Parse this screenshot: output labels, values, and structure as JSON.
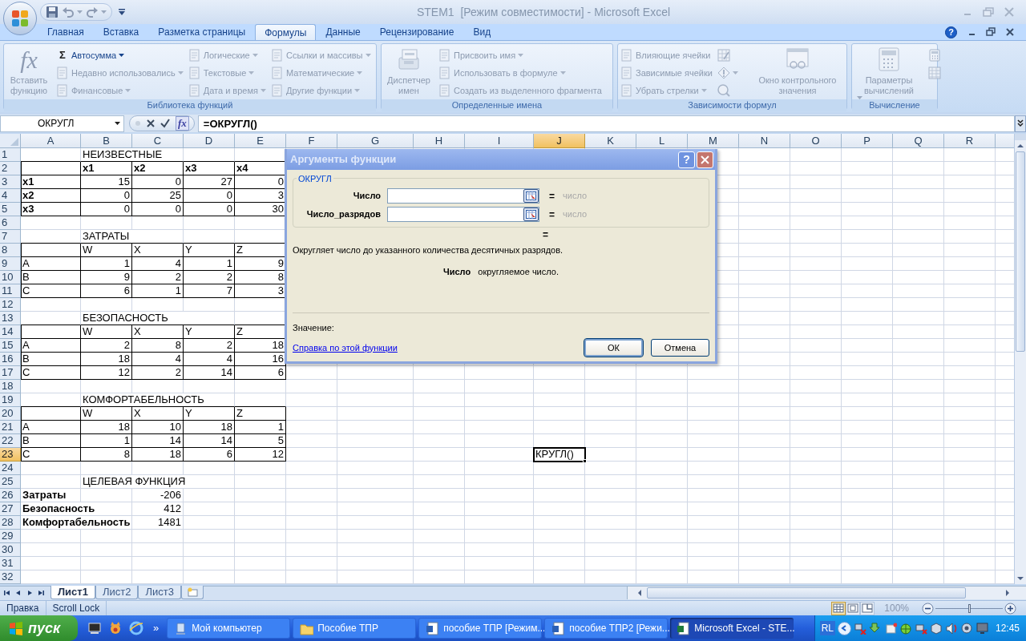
{
  "title_bar": {
    "title": "STEM1  [Режим совместимости] - Microsoft Excel"
  },
  "ribbon_tabs": [
    {
      "label": "Главная",
      "selected": false
    },
    {
      "label": "Вставка",
      "selected": false
    },
    {
      "label": "Разметка страницы",
      "selected": false
    },
    {
      "label": "Формулы",
      "selected": true
    },
    {
      "label": "Данные",
      "selected": false
    },
    {
      "label": "Рецензирование",
      "selected": false
    },
    {
      "label": "Вид",
      "selected": false
    }
  ],
  "ribbon_help": "?",
  "ribbon_groups": [
    {
      "label": "Библиотека функций",
      "items": [
        {
          "kind": "large",
          "label": "Вставить функцию",
          "symbol": "fx",
          "disabled": true,
          "dropdown": false
        },
        {
          "kind": "small",
          "label": "Автосумма",
          "symbol": "Σ",
          "disabled": false,
          "dropdown": true
        },
        {
          "kind": "small",
          "label": "Недавно использовались",
          "disabled": true,
          "dropdown": true
        },
        {
          "kind": "small",
          "label": "Финансовые",
          "disabled": true,
          "dropdown": true
        },
        {
          "kind": "small",
          "label": "Логические",
          "disabled": true,
          "dropdown": true
        },
        {
          "kind": "small",
          "label": "Текстовые",
          "disabled": true,
          "dropdown": true
        },
        {
          "kind": "small",
          "label": "Дата и время",
          "disabled": true,
          "dropdown": true
        },
        {
          "kind": "small",
          "label": "Ссылки и массивы",
          "disabled": true,
          "dropdown": true
        },
        {
          "kind": "small",
          "label": "Математические",
          "disabled": true,
          "dropdown": true
        },
        {
          "kind": "small",
          "label": "Другие функции",
          "disabled": true,
          "dropdown": true
        }
      ]
    },
    {
      "label": "Определенные имена",
      "items": [
        {
          "kind": "large",
          "label": "Диспетчер имен",
          "disabled": true,
          "dropdown": false
        },
        {
          "kind": "small",
          "label": "Присвоить имя",
          "disabled": true,
          "dropdown": true
        },
        {
          "kind": "small",
          "label": "Использовать в формуле",
          "disabled": true,
          "dropdown": true
        },
        {
          "kind": "small",
          "label": "Создать из выделенного фрагмента",
          "disabled": true,
          "dropdown": false
        }
      ]
    },
    {
      "label": "Зависимости формул",
      "items": [
        {
          "kind": "small",
          "label": "Влияющие ячейки",
          "disabled": true,
          "dropdown": false
        },
        {
          "kind": "small",
          "label": "Зависимые ячейки",
          "disabled": true,
          "dropdown": false
        },
        {
          "kind": "small",
          "label": "Убрать стрелки",
          "disabled": true,
          "dropdown": true
        },
        {
          "kind": "icon",
          "disabled": true,
          "dropdown": false
        },
        {
          "kind": "icon",
          "disabled": true,
          "dropdown": true
        },
        {
          "kind": "icon",
          "disabled": true,
          "dropdown": false
        },
        {
          "kind": "large",
          "label": "Окно контрольного значения",
          "disabled": true,
          "dropdown": false
        }
      ]
    },
    {
      "label": "Вычисление",
      "items": [
        {
          "kind": "large",
          "label": "Параметры вычислений",
          "disabled": true,
          "dropdown": true
        },
        {
          "kind": "icon",
          "disabled": true,
          "dropdown": false
        },
        {
          "kind": "icon",
          "disabled": true,
          "dropdown": false
        }
      ]
    }
  ],
  "formula_bar": {
    "name_box": "ОКРУГЛ",
    "function_button": "fx",
    "formula": "=ОКРУГЛ()"
  },
  "sheet": {
    "columns": [
      {
        "label": "A",
        "selected": false
      },
      {
        "label": "B",
        "selected": false
      },
      {
        "label": "C",
        "selected": false
      },
      {
        "label": "D",
        "selected": false
      },
      {
        "label": "E",
        "selected": false
      },
      {
        "label": "F",
        "selected": false
      },
      {
        "label": "G",
        "selected": false
      },
      {
        "label": "H",
        "selected": false
      },
      {
        "label": "I",
        "selected": false
      },
      {
        "label": "J",
        "selected": true
      },
      {
        "label": "K",
        "selected": false
      },
      {
        "label": "L",
        "selected": false
      },
      {
        "label": "M",
        "selected": false
      },
      {
        "label": "N",
        "selected": false
      },
      {
        "label": "O",
        "selected": false
      },
      {
        "label": "P",
        "selected": false
      },
      {
        "label": "Q",
        "selected": false
      },
      {
        "label": "R",
        "selected": false
      }
    ],
    "rows": [
      {
        "number": "1",
        "selected": false,
        "bordered": false,
        "cells": [
          null,
          {
            "text": "НЕИЗВЕСТНЫЕ",
            "kind": "text",
            "bold": false,
            "selected": false
          }
        ]
      },
      {
        "number": "2",
        "selected": false,
        "bordered": true,
        "cells": [
          null,
          {
            "text": "x1",
            "kind": "text",
            "bold": true,
            "selected": false
          },
          {
            "text": "x2",
            "kind": "text",
            "bold": true,
            "selected": false
          },
          {
            "text": "x3",
            "kind": "text",
            "bold": true,
            "selected": false
          },
          {
            "text": "x4",
            "kind": "text",
            "bold": true,
            "selected": false
          }
        ]
      },
      {
        "number": "3",
        "selected": false,
        "bordered": true,
        "cells": [
          {
            "text": "x1",
            "kind": "text",
            "bold": true,
            "selected": false
          },
          {
            "text": "15",
            "kind": "number",
            "bold": false,
            "selected": false
          },
          {
            "text": "0",
            "kind": "number",
            "bold": false,
            "selected": false
          },
          {
            "text": "27",
            "kind": "number",
            "bold": false,
            "selected": false
          },
          {
            "text": "0",
            "kind": "number",
            "bold": false,
            "selected": false
          }
        ]
      },
      {
        "number": "4",
        "selected": false,
        "bordered": true,
        "cells": [
          {
            "text": "x2",
            "kind": "text",
            "bold": true,
            "selected": false
          },
          {
            "text": "0",
            "kind": "number",
            "bold": false,
            "selected": false
          },
          {
            "text": "25",
            "kind": "number",
            "bold": false,
            "selected": false
          },
          {
            "text": "0",
            "kind": "number",
            "bold": false,
            "selected": false
          },
          {
            "text": "3",
            "kind": "number",
            "bold": false,
            "selected": false
          }
        ]
      },
      {
        "number": "5",
        "selected": false,
        "bordered": true,
        "cells": [
          {
            "text": "x3",
            "kind": "text",
            "bold": true,
            "selected": false
          },
          {
            "text": "0",
            "kind": "number",
            "bold": false,
            "selected": false
          },
          {
            "text": "0",
            "kind": "number",
            "bold": false,
            "selected": false
          },
          {
            "text": "0",
            "kind": "number",
            "bold": false,
            "selected": false
          },
          {
            "text": "30",
            "kind": "number",
            "bold": false,
            "selected": false
          }
        ]
      },
      {
        "number": "6",
        "selected": false,
        "bordered": false
      },
      {
        "number": "7",
        "selected": false,
        "bordered": false,
        "cells": [
          null,
          {
            "text": "ЗАТРАТЫ",
            "kind": "text",
            "bold": false,
            "selected": false
          }
        ]
      },
      {
        "number": "8",
        "selected": false,
        "bordered": true,
        "cells": [
          null,
          {
            "text": "W",
            "kind": "text",
            "bold": false,
            "selected": false
          },
          {
            "text": "X",
            "kind": "text",
            "bold": false,
            "selected": false
          },
          {
            "text": "Y",
            "kind": "text",
            "bold": false,
            "selected": false
          },
          {
            "text": "Z",
            "kind": "text",
            "bold": false,
            "selected": false
          }
        ]
      },
      {
        "number": "9",
        "selected": false,
        "bordered": true,
        "cells": [
          {
            "text": "A",
            "kind": "text",
            "bold": false,
            "selected": false
          },
          {
            "text": "1",
            "kind": "number",
            "bold": false,
            "selected": false
          },
          {
            "text": "4",
            "kind": "number",
            "bold": false,
            "selected": false
          },
          {
            "text": "1",
            "kind": "number",
            "bold": false,
            "selected": false
          },
          {
            "text": "9",
            "kind": "number",
            "bold": false,
            "selected": false
          }
        ]
      },
      {
        "number": "10",
        "selected": false,
        "bordered": true,
        "cells": [
          {
            "text": "B",
            "kind": "text",
            "bold": false,
            "selected": false
          },
          {
            "text": "9",
            "kind": "number",
            "bold": false,
            "selected": false
          },
          {
            "text": "2",
            "kind": "number",
            "bold": false,
            "selected": false
          },
          {
            "text": "2",
            "kind": "number",
            "bold": false,
            "selected": false
          },
          {
            "text": "8",
            "kind": "number",
            "bold": false,
            "selected": false
          }
        ]
      },
      {
        "number": "11",
        "selected": false,
        "bordered": true,
        "cells": [
          {
            "text": "C",
            "kind": "text",
            "bold": false,
            "selected": false
          },
          {
            "text": "6",
            "kind": "number",
            "bold": false,
            "selected": false
          },
          {
            "text": "1",
            "kind": "number",
            "bold": false,
            "selected": false
          },
          {
            "text": "7",
            "kind": "number",
            "bold": false,
            "selected": false
          },
          {
            "text": "3",
            "kind": "number",
            "bold": false,
            "selected": false
          }
        ]
      },
      {
        "number": "12",
        "selected": false,
        "bordered": false
      },
      {
        "number": "13",
        "selected": false,
        "bordered": false,
        "cells": [
          null,
          {
            "text": "БЕЗОПАСНОСТЬ",
            "kind": "text",
            "bold": false,
            "selected": false
          }
        ]
      },
      {
        "number": "14",
        "selected": false,
        "bordered": true,
        "cells": [
          null,
          {
            "text": "W",
            "kind": "text",
            "bold": false,
            "selected": false
          },
          {
            "text": "X",
            "kind": "text",
            "bold": false,
            "selected": false
          },
          {
            "text": "Y",
            "kind": "text",
            "bold": false,
            "selected": false
          },
          {
            "text": "Z",
            "kind": "text",
            "bold": false,
            "selected": false
          }
        ]
      },
      {
        "number": "15",
        "selected": false,
        "bordered": true,
        "cells": [
          {
            "text": "A",
            "kind": "text",
            "bold": false,
            "selected": false
          },
          {
            "text": "2",
            "kind": "number",
            "bold": false,
            "selected": false
          },
          {
            "text": "8",
            "kind": "number",
            "bold": false,
            "selected": false
          },
          {
            "text": "2",
            "kind": "number",
            "bold": false,
            "selected": false
          },
          {
            "text": "18",
            "kind": "number",
            "bold": false,
            "selected": false
          }
        ]
      },
      {
        "number": "16",
        "selected": false,
        "bordered": true,
        "cells": [
          {
            "text": "B",
            "kind": "text",
            "bold": false,
            "selected": false
          },
          {
            "text": "18",
            "kind": "number",
            "bold": false,
            "selected": false
          },
          {
            "text": "4",
            "kind": "number",
            "bold": false,
            "selected": false
          },
          {
            "text": "4",
            "kind": "number",
            "bold": false,
            "selected": false
          },
          {
            "text": "16",
            "kind": "number",
            "bold": false,
            "selected": false
          }
        ]
      },
      {
        "number": "17",
        "selected": false,
        "bordered": true,
        "cells": [
          {
            "text": "C",
            "kind": "text",
            "bold": false,
            "selected": false
          },
          {
            "text": "12",
            "kind": "number",
            "bold": false,
            "selected": false
          },
          {
            "text": "2",
            "kind": "number",
            "bold": false,
            "selected": false
          },
          {
            "text": "14",
            "kind": "number",
            "bold": false,
            "selected": false
          },
          {
            "text": "6",
            "kind": "number",
            "bold": false,
            "selected": false
          }
        ]
      },
      {
        "number": "18",
        "selected": false,
        "bordered": false
      },
      {
        "number": "19",
        "selected": false,
        "bordered": false,
        "cells": [
          null,
          {
            "text": "КОМФОРТАБЕЛЬНОСТЬ",
            "kind": "text",
            "bold": false,
            "selected": false
          }
        ]
      },
      {
        "number": "20",
        "selected": false,
        "bordered": true,
        "cells": [
          null,
          {
            "text": "W",
            "kind": "text",
            "bold": false,
            "selected": false
          },
          {
            "text": "X",
            "kind": "text",
            "bold": false,
            "selected": false
          },
          {
            "text": "Y",
            "kind": "text",
            "bold": false,
            "selected": false
          },
          {
            "text": "Z",
            "kind": "text",
            "bold": false,
            "selected": false
          }
        ]
      },
      {
        "number": "21",
        "selected": false,
        "bordered": true,
        "cells": [
          {
            "text": "A",
            "kind": "text",
            "bold": false,
            "selected": false
          },
          {
            "text": "18",
            "kind": "number",
            "bold": false,
            "selected": false
          },
          {
            "text": "10",
            "kind": "number",
            "bold": false,
            "selected": false
          },
          {
            "text": "18",
            "kind": "number",
            "bold": false,
            "selected": false
          },
          {
            "text": "1",
            "kind": "number",
            "bold": false,
            "selected": false
          }
        ]
      },
      {
        "number": "22",
        "selected": false,
        "bordered": true,
        "cells": [
          {
            "text": "B",
            "kind": "text",
            "bold": false,
            "selected": false
          },
          {
            "text": "1",
            "kind": "number",
            "bold": false,
            "selected": false
          },
          {
            "text": "14",
            "kind": "number",
            "bold": false,
            "selected": false
          },
          {
            "text": "14",
            "kind": "number",
            "bold": false,
            "selected": false
          },
          {
            "text": "5",
            "kind": "number",
            "bold": false,
            "selected": false
          }
        ]
      },
      {
        "number": "23",
        "selected": true,
        "bordered": true,
        "cells": [
          {
            "text": "C",
            "kind": "text",
            "bold": false,
            "selected": false
          },
          {
            "text": "8",
            "kind": "number",
            "bold": false,
            "selected": false
          },
          {
            "text": "18",
            "kind": "number",
            "bold": false,
            "selected": false
          },
          {
            "text": "6",
            "kind": "number",
            "bold": false,
            "selected": false
          },
          {
            "text": "12",
            "kind": "number",
            "bold": false,
            "selected": false
          },
          null,
          null,
          null,
          null,
          {
            "text": "КРУГЛ()",
            "kind": "text",
            "bold": false,
            "selected": true
          }
        ]
      },
      {
        "number": "24",
        "selected": false,
        "bordered": false
      },
      {
        "number": "25",
        "selected": false,
        "bordered": false,
        "cells": [
          null,
          {
            "text": "ЦЕЛЕВАЯ ФУНКЦИЯ",
            "kind": "text",
            "bold": false,
            "selected": false
          }
        ]
      },
      {
        "number": "26",
        "selected": false,
        "bordered": false,
        "cells": [
          {
            "text": "Затраты",
            "kind": "text",
            "bold": true,
            "selected": false
          },
          null,
          {
            "text": "-206",
            "kind": "number",
            "bold": false,
            "selected": false
          }
        ]
      },
      {
        "number": "27",
        "selected": false,
        "bordered": false,
        "cells": [
          {
            "text": "Безопасность",
            "kind": "text",
            "bold": true,
            "selected": false
          },
          null,
          {
            "text": "412",
            "kind": "number",
            "bold": false,
            "selected": false
          }
        ]
      },
      {
        "number": "28",
        "selected": false,
        "bordered": false,
        "cells": [
          {
            "text": "Комфортабельность",
            "kind": "text",
            "bold": true,
            "selected": false
          },
          null,
          {
            "text": "1481",
            "kind": "number",
            "bold": false,
            "selected": false
          }
        ]
      },
      {
        "number": "29",
        "selected": false,
        "bordered": false
      },
      {
        "number": "30",
        "selected": false,
        "bordered": false
      },
      {
        "number": "31",
        "selected": false,
        "bordered": false
      },
      {
        "number": "32",
        "selected": false,
        "bordered": false
      }
    ]
  },
  "dialog": {
    "title": "Аргументы функции",
    "help_button": "?",
    "function_name": "ОКРУГЛ",
    "arguments": [
      {
        "label": "Число",
        "equals": "=",
        "result": "число"
      },
      {
        "label": "Число_разрядов",
        "equals": "=",
        "result": "число"
      }
    ],
    "result_equals": "=",
    "description": "Округляет число до указанного количества десятичных разрядов.",
    "argument_help": "**Число**   округляемое число.",
    "value_label": "Значение:",
    "help_link": "Справка по этой функции",
    "buttons": [
      {
        "label": "ОК",
        "default": true
      },
      {
        "label": "Отмена",
        "default": false
      }
    ]
  },
  "sheet_tabs": [
    {
      "label": "Лист1",
      "selected": true
    },
    {
      "label": "Лист2",
      "selected": false
    },
    {
      "label": "Лист3",
      "selected": false
    }
  ],
  "status_bar": {
    "items": [
      "Правка",
      "Scroll Lock"
    ],
    "view_buttons": [
      {
        "selected": true
      },
      {
        "selected": false
      },
      {
        "selected": false
      }
    ],
    "zoom": "100%",
    "zoom_slider": {
      "level": 0.5
    }
  },
  "taskbar": {
    "start": "пуск",
    "overflow": "»",
    "tasks": [
      {
        "label": "Мой компьютер",
        "kind": "computer",
        "selected": false
      },
      {
        "label": "Пособие ТПР",
        "kind": "folder",
        "selected": false
      },
      {
        "label": "пособие ТПР [Режим...",
        "kind": "document",
        "selected": false
      },
      {
        "label": "пособие ТПР2 [Режи...",
        "kind": "document",
        "selected": false
      },
      {
        "label": "Microsoft Excel - STE...",
        "kind": "spreadsheet",
        "selected": true
      }
    ],
    "language": "RL",
    "clock": "12:45"
  }
}
